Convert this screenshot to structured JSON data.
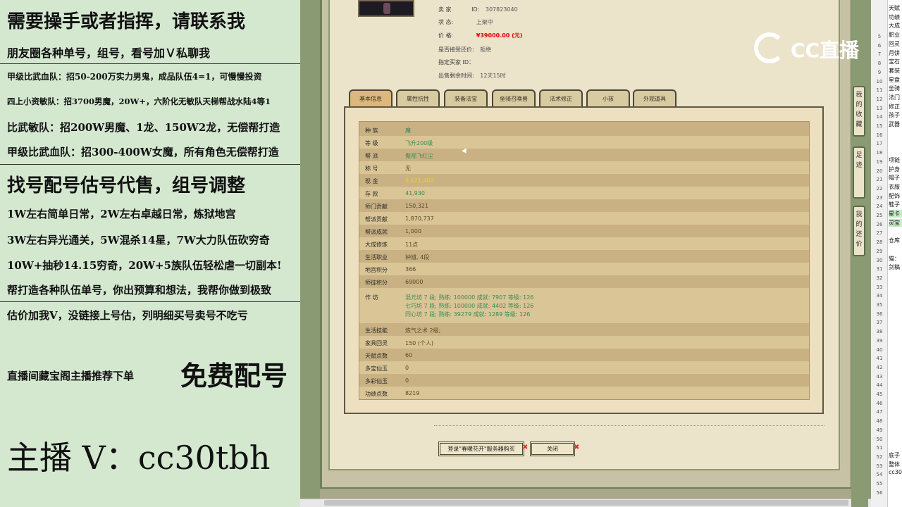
{
  "left_overlay": {
    "lines": [
      "需要操手或者指挥，请联系我",
      "朋友圈各种单号，组号，看号加Ｖ私聊我",
      "甲级比武血队：招50-200万实力男鬼，成品队伍4=1，可慢慢投资",
      "四上小资敏队：招3700男魔，20W+，六阶化无敏队天梯帮战水陆4等1",
      "比武敏队：招200W男魔、1龙、150W2龙，无偿帮打造",
      "甲级比武血队：招300-400W女魔，所有角色无偿帮打造",
      "找号配号估号代售，组号调整",
      "1W左右简单日常，2W左右卓越日常，炼狱地宫",
      "3W左右异光通关，5W混杀14星，7W大力队伍砍穷奇",
      "10W+抽秒14.15穷奇，20W+5族队伍轻松虐一切副本!",
      "帮打造各种队伍单号，你出预算和想法，我帮你做到极致",
      "估价加我V，没链接上号估，列明细买号卖号不吃亏"
    ],
    "free_match_prefix": "直播间藏宝阁主播推荐下单",
    "free_match_big": "免费配号",
    "anchor_contact": "主播 V：cc30tbh"
  },
  "seller_info": {
    "seller_label": "卖 家",
    "seller_id_label": "ID:",
    "seller_id": "307823040",
    "status_label": "状 态:",
    "status": "上架中",
    "price_label": "价 格:",
    "price": "¥39000.00 (元)",
    "bargain_label": "是否接受还价:",
    "bargain": "拒绝",
    "buyer_label": "指定买家 ID：",
    "buyer": "",
    "time_label": "出售剩余时间:",
    "time": "12天15时"
  },
  "tabs": [
    "基本信息",
    "属性抗性",
    "装备法宝",
    "坐骑召唤兽",
    "法术修正",
    "小孩",
    "外观道具"
  ],
  "rows": [
    {
      "k": "种 族",
      "v": "魔"
    },
    {
      "k": "等 级",
      "v": "飞升200级"
    },
    {
      "k": "帮 派",
      "v": "傲视飞红尘"
    },
    {
      "k": "称 号",
      "v": "无"
    },
    {
      "k": "现 金",
      "v": "8,621,460"
    },
    {
      "k": "存 款",
      "v": "41,930"
    },
    {
      "k": "师门贡献",
      "v": "150,321"
    },
    {
      "k": "帮派贡献",
      "v": "1,870,737"
    },
    {
      "k": "帮派成就",
      "v": "1,000"
    },
    {
      "k": "大成修炼",
      "v": "11点"
    },
    {
      "k": "生活职业",
      "v": "钟馗, 4段"
    },
    {
      "k": "地宫积分",
      "v": "366"
    },
    {
      "k": "师徒积分",
      "v": "69000"
    }
  ],
  "workshop": {
    "k": "作 坊",
    "lines": [
      "混元坊 7 段; 熟练: 100000 成就: 7907 等级: 126",
      "七巧坊 7 段; 熟练: 100000 成就: 4402 等级: 126",
      "同心坊 7 段; 熟练: 39279 成就: 1289 等级: 126"
    ]
  },
  "rows2": [
    {
      "k": "生活技能",
      "v": "炼气之术 2级;"
    },
    {
      "k": "家具回灵",
      "v": "150 (个人)"
    },
    {
      "k": "天赋点数",
      "v": "60"
    },
    {
      "k": "多宝仙玉",
      "v": "0"
    },
    {
      "k": "多彩仙玉",
      "v": "0"
    },
    {
      "k": "功绩点数",
      "v": "8219"
    }
  ],
  "buttons": {
    "login_buy": "登录\"春暖花开\"服务器购买",
    "close": "关闭"
  },
  "logo_text": "CC直播",
  "side_tabs": [
    "我的收藏",
    "足迹",
    "我的还价"
  ],
  "sheet_rows": [
    "5",
    "6",
    "7",
    "8",
    "9",
    "10",
    "11",
    "12",
    "13",
    "14",
    "15",
    "16",
    "17",
    "18",
    "19",
    "20",
    "21",
    "22",
    "23",
    "24",
    "25",
    "26",
    "27",
    "28",
    "29",
    "30",
    "31",
    "32",
    "33",
    "34",
    "35",
    "36",
    "37",
    "38",
    "39",
    "40",
    "41",
    "42",
    "43",
    "44",
    "45",
    "46",
    "47",
    "48",
    "49",
    "50",
    "51",
    "52",
    "53",
    "54",
    "55",
    "56"
  ],
  "sheet_cells": [
    "天赋",
    "功绩",
    "大成",
    "职业",
    "回灵",
    "月饼",
    "宝石",
    "套装",
    "星盘",
    "坐骑",
    "法门",
    "修正",
    "孩子",
    "武器",
    "项链",
    "护身",
    "帽子",
    "衣服",
    "配饰",
    "鞋子",
    "星卡",
    "灵宝",
    "仓库",
    "猫：",
    "剑稿",
    "底子",
    "整体",
    "cc30"
  ]
}
